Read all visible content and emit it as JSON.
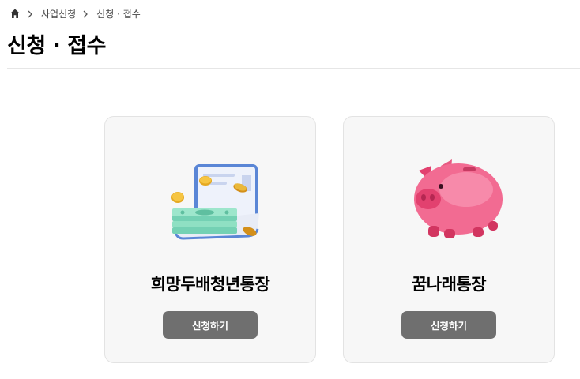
{
  "breadcrumb": {
    "home_icon": "home-icon",
    "items": [
      "사업신청",
      "신청 · 접수"
    ]
  },
  "page": {
    "title": "신청 · 접수"
  },
  "cards": [
    {
      "title": "희망두배청년통장",
      "button": "신청하기",
      "icon": "wallet-money-icon"
    },
    {
      "title": "꿈나래통장",
      "button": "신청하기",
      "icon": "piggy-bank-icon"
    }
  ],
  "colors": {
    "button_bg": "#6f6f6f",
    "card_bg": "#f7f7f7"
  }
}
